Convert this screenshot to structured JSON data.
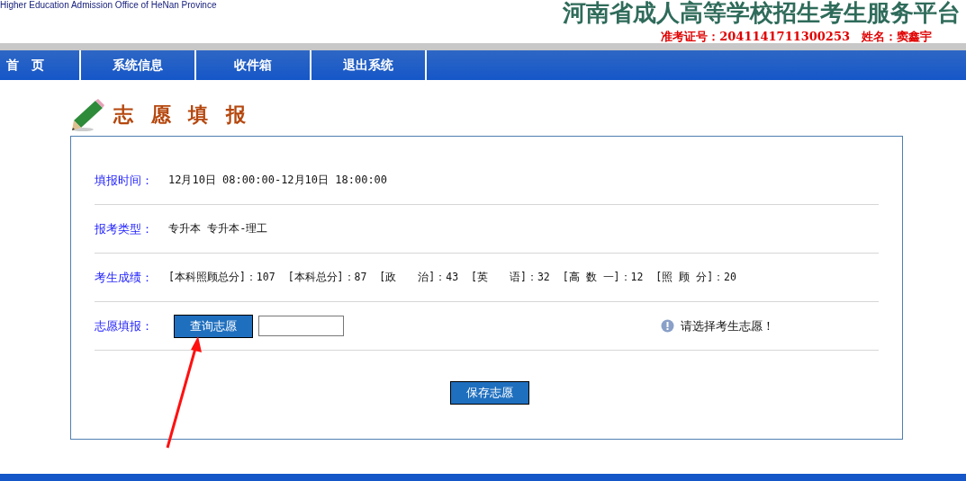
{
  "header": {
    "subtitle": "Higher Education Admission Office of HeNan Province",
    "title": "河南省成人高等学校招生考生服务平台",
    "exam_id_label": "准考证号：",
    "exam_id": "2041141711300253",
    "name_label": "姓名：",
    "name": "窦鑫宇"
  },
  "nav": [
    {
      "label": "首　页"
    },
    {
      "label": "系统信息"
    },
    {
      "label": "收件箱"
    },
    {
      "label": "退出系统"
    }
  ],
  "section_title": "志 愿 填 报",
  "rows": [
    {
      "kind": "text",
      "label": "填报时间：",
      "value": "12月10日 08:00:00-12月10日 18:00:00"
    },
    {
      "kind": "text",
      "label": "报考类型：",
      "value": "专升本 专升本-理工"
    },
    {
      "kind": "scores",
      "label": "考生成绩：",
      "scores": [
        {
          "name": "[本科照顾总分]",
          "value": "：107"
        },
        {
          "name": "[本科总分]",
          "value": "：87"
        },
        {
          "name": "[政　　治]",
          "value": "：43"
        },
        {
          "name": "[英　　语]",
          "value": "：32"
        },
        {
          "name": "[高 数 一]",
          "value": "：12"
        },
        {
          "name": "[照 顾 分]",
          "value": "：20"
        }
      ]
    },
    {
      "kind": "query",
      "label": "志愿填报：",
      "button": "查询志愿",
      "hint": "请选择考生志愿！"
    }
  ],
  "save_button": "保存志愿"
}
